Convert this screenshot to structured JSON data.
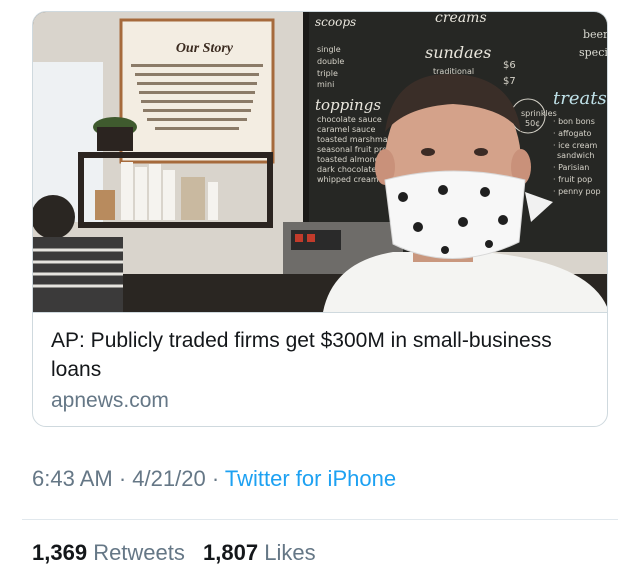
{
  "link_card": {
    "title": "AP: Publicly traded firms get $300M in small-business loans",
    "domain": "apnews.com",
    "image": {
      "sign_heading": "Our Story",
      "sign_text": "The Penny Ice Creamery is the only ice cream shop in Santa Cruz making delicious ice cream completely from scratch in house. Our flavors change with the seasons, and feature locally farmed and organic ingredients.",
      "board_words": [
        "scoops",
        "creams",
        "sundaes",
        "toppings",
        "treats"
      ],
      "board_lines": [
        "single",
        "double",
        "triple",
        "mini",
        "traditional",
        "$6",
        "$7",
        "chocolate sauce",
        "caramel sauce",
        "toasted marshmallow",
        "seasonal fruit preserves",
        "toasted almonds",
        "dark chocolate cookie",
        "whipped cream",
        "sprinkles 50¢",
        "bon bons",
        "affogato",
        "ice cream sandwich",
        "Parisian",
        "fruit pop",
        "penny pop",
        "beer",
        "special"
      ]
    }
  },
  "tweet_meta": {
    "time": "6:43 AM",
    "separator": "·",
    "date": "4/21/20",
    "source": "Twitter for iPhone"
  },
  "stats": {
    "retweets_count": "1,369",
    "retweets_label": "Retweets",
    "likes_count": "1,807",
    "likes_label": "Likes"
  }
}
